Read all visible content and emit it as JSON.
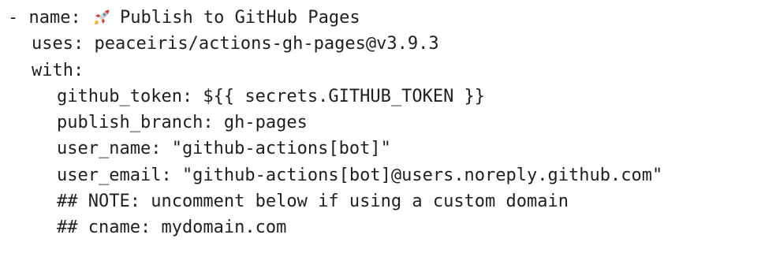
{
  "code": {
    "line1_prefix": "- name: ",
    "line1_icon": "rocket-icon",
    "line1_text": "Publish to GitHub Pages",
    "line2": "uses: peaceiris/actions-gh-pages@v3.9.3",
    "line3": "with:",
    "line4": "github_token: ${{ secrets.GITHUB_TOKEN }}",
    "line5": "publish_branch: gh-pages",
    "line6": "user_name: \"github-actions[bot]\"",
    "line7": "user_email: \"github-actions[bot]@users.noreply.github.com\"",
    "line8": "## NOTE: uncomment below if using a custom domain",
    "line9": "## cname: mydomain.com"
  }
}
